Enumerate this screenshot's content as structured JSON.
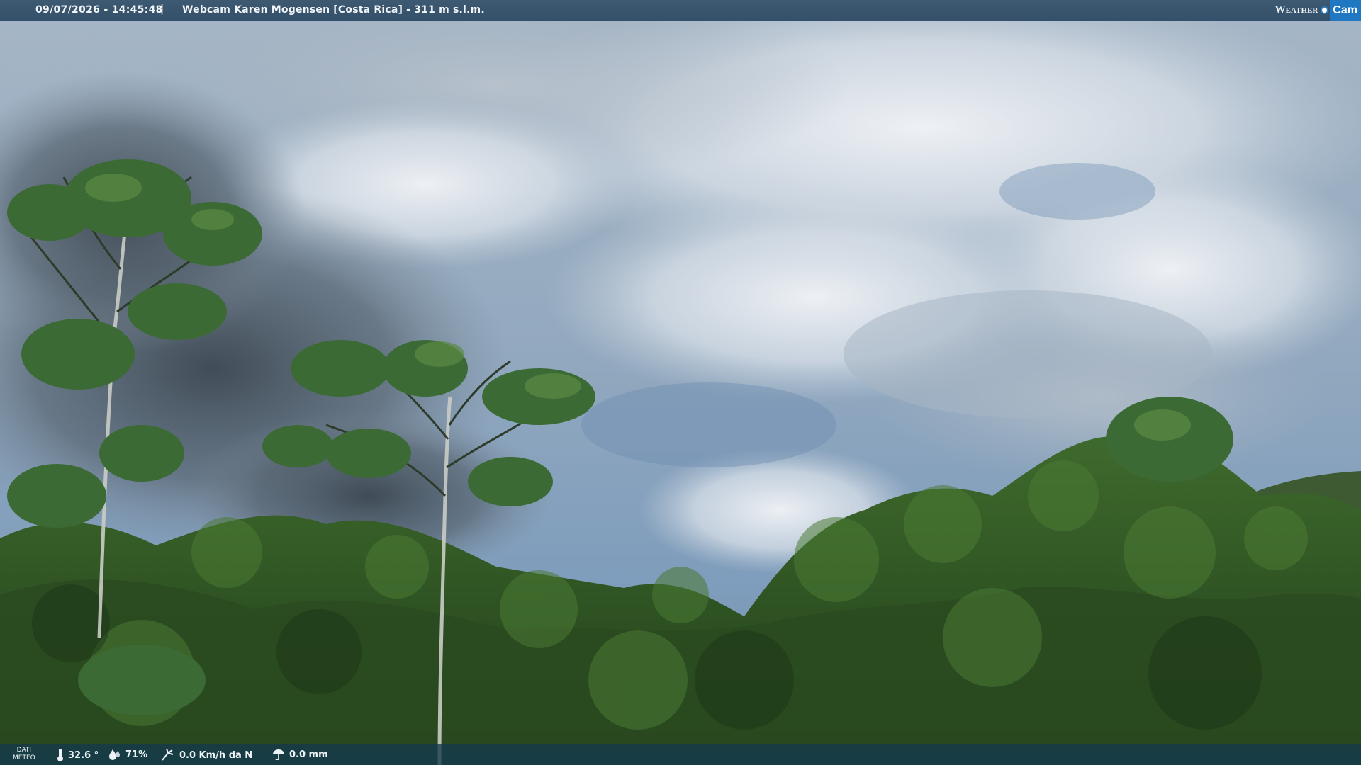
{
  "header": {
    "datetime": "09/07/2026 - 14:45:48",
    "separator": "|",
    "title": "Webcam Karen Mogensen [Costa Rica] - 311 m s.l.m.",
    "brand_left": "Weather",
    "brand_right": "Cam",
    "brand_color": "#1f78c1"
  },
  "weather_bar": {
    "label_line1": "DATI",
    "label_line2": "METEO",
    "temperature": "32.6 °",
    "humidity": "71%",
    "wind": "0.0 Km/h da N",
    "rain": "0.0 mm",
    "icons": [
      "thermometer-icon",
      "humidity-drop-icon",
      "wind-icon",
      "rain-umbrella-icon"
    ]
  },
  "scene": {
    "description_colors": {
      "sky": "#8ea7c0",
      "cloud": "#e3e8ee",
      "dark_cloud": "#4d5a66",
      "forest": "#2b4f22"
    }
  }
}
